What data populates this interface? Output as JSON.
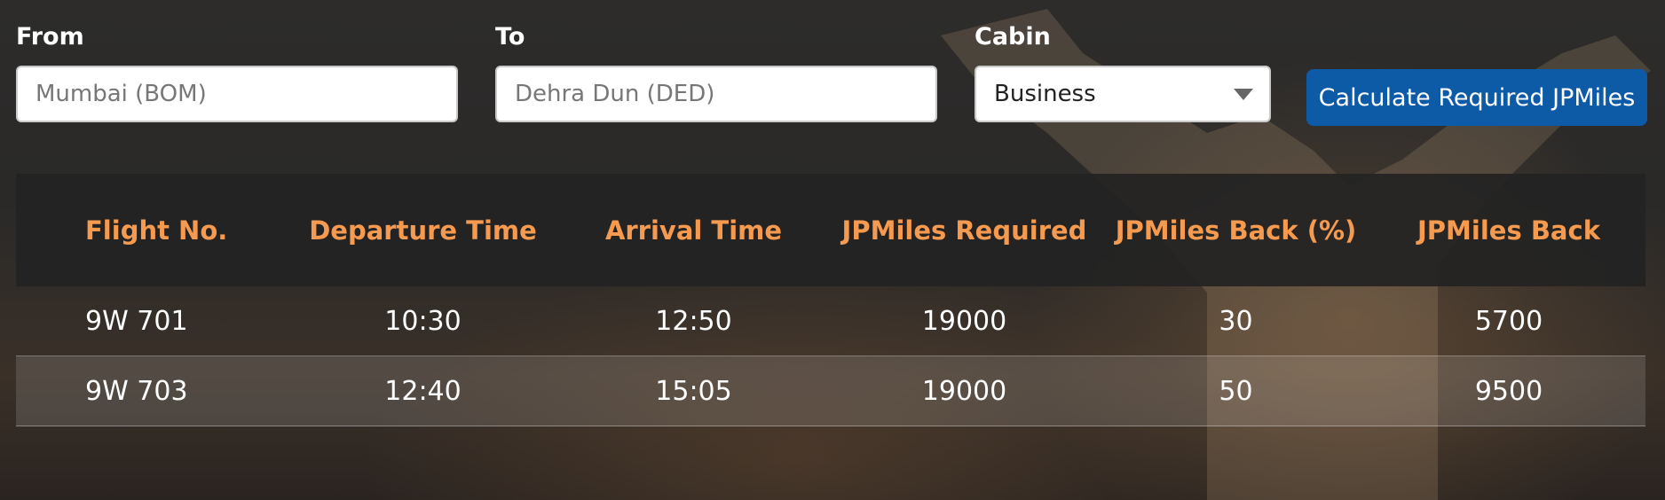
{
  "form": {
    "from": {
      "label": "From",
      "placeholder": "Mumbai (BOM)"
    },
    "to": {
      "label": "To",
      "placeholder": "Dehra Dun (DED)"
    },
    "cabin": {
      "label": "Cabin",
      "value": "Business"
    },
    "calculate_button": "Calculate Required JPMiles"
  },
  "table": {
    "headers": [
      "Flight No.",
      "Departure Time",
      "Arrival Time",
      "JPMiles Required",
      "JPMiles Back (%)",
      "JPMiles Back"
    ],
    "rows": [
      [
        "9W 701",
        "10:30",
        "12:50",
        "19000",
        "30",
        "5700"
      ],
      [
        "9W 703",
        "12:40",
        "15:05",
        "19000",
        "50",
        "9500"
      ]
    ]
  },
  "colors": {
    "accent_header_text": "#f59a4f",
    "button_blue": "#0d5aa7",
    "background": "#2b2a29"
  }
}
